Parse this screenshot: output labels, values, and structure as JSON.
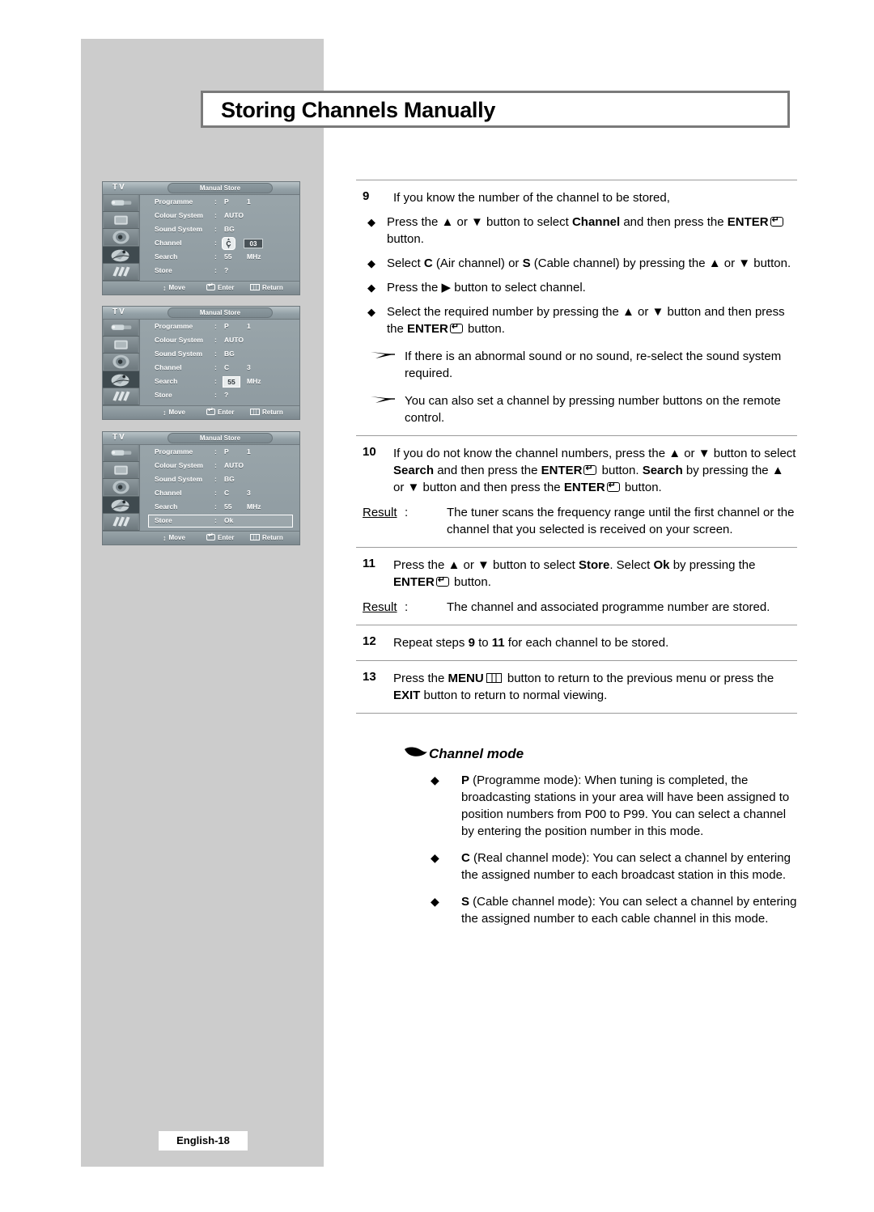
{
  "page": {
    "title": "Storing Channels Manually",
    "footer_label": "English-18",
    "background_color": "#cccccc"
  },
  "osd_menus": [
    {
      "tv_label": "TV",
      "menu_title": "Manual Store",
      "selected_icon_index": 3,
      "icons": [
        "input-source-icon",
        "picture-icon",
        "sound-icon",
        "channel-tuning-icon",
        "setup-icon"
      ],
      "rows": [
        {
          "label": "Programme",
          "colon": ":",
          "value": "P",
          "value2": "1",
          "widget": "none"
        },
        {
          "label": "Colour System",
          "colon": ":",
          "value": "AUTO",
          "value2": "",
          "widget": "none"
        },
        {
          "label": "Sound System",
          "colon": ":",
          "value": "BG",
          "value2": "",
          "widget": "none"
        },
        {
          "label": "Channel",
          "colon": ":",
          "value": "C",
          "value2": "03",
          "widget": "spinner-and-inverted"
        },
        {
          "label": "Search",
          "colon": ":",
          "value": "55",
          "value2": "MHz",
          "widget": "none"
        },
        {
          "label": "Store",
          "colon": ":",
          "value": "?",
          "value2": "",
          "widget": "none"
        }
      ],
      "footer": {
        "move": "Move",
        "enter": "Enter",
        "return": "Return"
      }
    },
    {
      "tv_label": "TV",
      "menu_title": "Manual Store",
      "selected_icon_index": 3,
      "icons": [
        "input-source-icon",
        "picture-icon",
        "sound-icon",
        "channel-tuning-icon",
        "setup-icon"
      ],
      "rows": [
        {
          "label": "Programme",
          "colon": ":",
          "value": "P",
          "value2": "1",
          "widget": "none"
        },
        {
          "label": "Colour System",
          "colon": ":",
          "value": "AUTO",
          "value2": "",
          "widget": "none"
        },
        {
          "label": "Sound System",
          "colon": ":",
          "value": "BG",
          "value2": "",
          "widget": "none"
        },
        {
          "label": "Channel",
          "colon": ":",
          "value": "C",
          "value2": "3",
          "widget": "none"
        },
        {
          "label": "Search",
          "colon": ":",
          "value": "55",
          "value2": "MHz",
          "widget": "boxed-value"
        },
        {
          "label": "Store",
          "colon": ":",
          "value": "?",
          "value2": "",
          "widget": "none"
        }
      ],
      "footer": {
        "move": "Move",
        "enter": "Enter",
        "return": "Return"
      }
    },
    {
      "tv_label": "TV",
      "menu_title": "Manual Store",
      "selected_icon_index": 3,
      "icons": [
        "input-source-icon",
        "picture-icon",
        "sound-icon",
        "channel-tuning-icon",
        "setup-icon"
      ],
      "rows": [
        {
          "label": "Programme",
          "colon": ":",
          "value": "P",
          "value2": "1",
          "widget": "none"
        },
        {
          "label": "Colour System",
          "colon": ":",
          "value": "AUTO",
          "value2": "",
          "widget": "none"
        },
        {
          "label": "Sound System",
          "colon": ":",
          "value": "BG",
          "value2": "",
          "widget": "none"
        },
        {
          "label": "Channel",
          "colon": ":",
          "value": "C",
          "value2": "3",
          "widget": "none"
        },
        {
          "label": "Search",
          "colon": ":",
          "value": "55",
          "value2": "MHz",
          "widget": "none"
        },
        {
          "label": "Store",
          "colon": ":",
          "value": "Ok",
          "value2": "",
          "widget": "row-highlight"
        }
      ],
      "footer": {
        "move": "Move",
        "enter": "Enter",
        "return": "Return"
      }
    }
  ],
  "steps": {
    "s9": {
      "num": "9",
      "intro": "If you know the number of the channel to be stored,",
      "b1_a": "Press the ▲ or ▼ button to select ",
      "b1_b": "Channel",
      "b1_c": " and then press the ",
      "b1_d": "ENTER",
      "b1_e": " button.",
      "b2_a": "Select ",
      "b2_b": "C",
      "b2_c": " (Air channel) or ",
      "b2_d": "S",
      "b2_e": " (Cable channel) by pressing the ▲ or ▼ button.",
      "b3": "Press the ▶ button to select channel.",
      "b4_a": "Select the required number by pressing the ▲ or ▼ button and then press the ",
      "b4_b": "ENTER",
      "b4_c": " button.",
      "note1": "If there is an abnormal sound or no sound, re-select the sound system required.",
      "note2": "You can also set a channel by pressing number buttons on the remote control."
    },
    "s10": {
      "num": "10",
      "t1": "If you do not know the channel numbers, press the ▲ or ▼ button to select ",
      "t2": "Search",
      "t3": " and then press the ",
      "t4": "ENTER",
      "t5": " button. ",
      "t6": "Search",
      "t7": " by pressing the ▲ or ▼ button and then press the ",
      "t8": "ENTER",
      "t9": " button.",
      "result_label": "Result",
      "result_colon": ":",
      "result_text": "The tuner scans the frequency range until the first channel or the channel that you selected is received on your screen."
    },
    "s11": {
      "num": "11",
      "t1": "Press the ▲ or ▼ button to select ",
      "t2": "Store",
      "t3": ". Select ",
      "t4": "Ok",
      "t5": " by pressing the ",
      "t6": "ENTER",
      "t7": " button.",
      "result_label": "Result",
      "result_colon": ":",
      "result_text": "The channel and associated programme number are stored."
    },
    "s12": {
      "num": "12",
      "t1": "Repeat steps ",
      "t2": "9",
      "t3": " to ",
      "t4": "11",
      "t5": " for each channel to be stored."
    },
    "s13": {
      "num": "13",
      "t1": "Press the ",
      "t2": "MENU",
      "t3": " button to return to the previous menu or press the ",
      "t4": "EXIT",
      "t5": " button to return to normal viewing."
    }
  },
  "channel_mode": {
    "heading": "Channel mode",
    "items": [
      {
        "code": "P",
        "text": " (Programme mode): When tuning is completed, the broadcasting stations in your area will have been assigned to position numbers from P00 to P99. You can select a channel by entering the position number in this mode."
      },
      {
        "code": "C",
        "text": " (Real channel mode): You can select a channel by entering the assigned number to each broadcast station in this mode."
      },
      {
        "code": "S",
        "text": " (Cable channel mode): You can select a channel by entering the assigned number to each cable channel in this mode."
      }
    ]
  }
}
